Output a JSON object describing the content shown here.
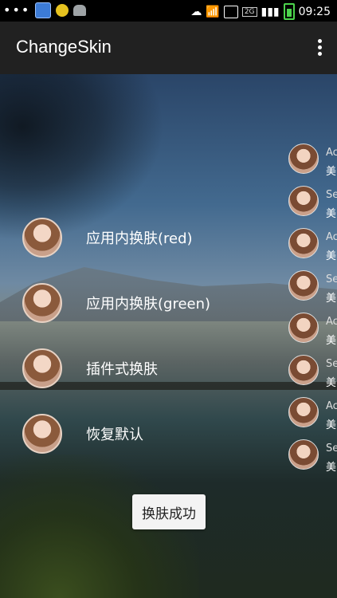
{
  "status_bar": {
    "time": "09:25",
    "network": "2G",
    "icons": [
      "dots-icon",
      "app-blue-icon",
      "chat-yellow-icon",
      "android-icon",
      "cloud-icon",
      "wifi-icon",
      "sim-icon",
      "signal-icon",
      "battery-icon"
    ]
  },
  "action_bar": {
    "title": "ChangeSkin",
    "overflow_icon": "more-vertical-icon"
  },
  "menu": {
    "items": [
      {
        "label": "应用内换肤(red)"
      },
      {
        "label": "应用内换肤(green)"
      },
      {
        "label": "插件式换肤"
      },
      {
        "label": "恢复默认"
      }
    ]
  },
  "right_list": {
    "items": [
      {
        "title": "Ac",
        "subtitle": "美"
      },
      {
        "title": "Se",
        "subtitle": "美"
      },
      {
        "title": "Ac",
        "subtitle": "美"
      },
      {
        "title": "Se",
        "subtitle": "美"
      },
      {
        "title": "Ac",
        "subtitle": "美"
      },
      {
        "title": "Se",
        "subtitle": "美"
      },
      {
        "title": "Ac",
        "subtitle": "美"
      },
      {
        "title": "Se",
        "subtitle": "美"
      }
    ]
  },
  "toast": {
    "message": "换肤成功"
  }
}
